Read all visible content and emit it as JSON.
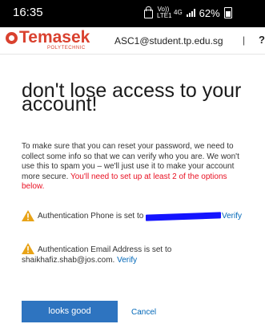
{
  "status_bar": {
    "time": "16:35",
    "volte": "Vo)) LTE1",
    "network": "4G",
    "battery": "62%"
  },
  "header": {
    "logo_word": "Temasek",
    "logo_sub": "POLYTECHNIC",
    "account_email": "ASC1@student.tp.edu.sg",
    "separator": "|",
    "help": "?"
  },
  "main": {
    "title": "don't lose access to your account!",
    "description": "To make sure that you can reset your password, we need to collect some info so that we can verify who you are. We won't use this to spam you – we'll just use it to make your account more secure. ",
    "requirement": "You'll need to set up at least 2 of the options below.",
    "phone": {
      "label": "Authentication Phone is set to",
      "verify": "Verify"
    },
    "email": {
      "label": "Authentication Email Address is set to",
      "value": "shaikhafiz.shab@jos.com.",
      "verify": "Verify"
    }
  },
  "actions": {
    "primary": "looks good",
    "cancel": "Cancel"
  },
  "colors": {
    "accent": "#2e74c0",
    "link": "#0067b8",
    "warning": "#e8a317",
    "requirement": "#e81123",
    "brand": "#d9412f"
  }
}
